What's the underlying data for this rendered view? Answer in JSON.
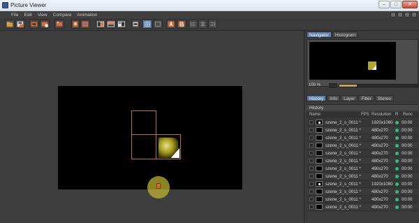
{
  "window": {
    "title": "Picture Viewer"
  },
  "menu": [
    "File",
    "Edit",
    "View",
    "Compare",
    "Animation"
  ],
  "side": {
    "top_tabs": [
      "Navigator",
      "Histogram"
    ],
    "zoom": "100 %",
    "zoom_fraction": 0.22,
    "bottom_tabs": [
      "History",
      "Info",
      "Layer",
      "Filter",
      "Stereo"
    ],
    "history_title": "History",
    "columns": {
      "name": "Name",
      "fps": "FPS",
      "resolution": "Resolution",
      "r": "R",
      "rend": "Renc"
    },
    "rows": [
      {
        "name": "szene_2_s_0011 *",
        "res": "1920x1080",
        "rend": "00:00",
        "thumb": "white"
      },
      {
        "name": "szene_2_s_0011 *",
        "res": "480x270",
        "rend": "00:00",
        "thumb": "black"
      },
      {
        "name": "szene_2_s_0011 *",
        "res": "480x270",
        "rend": "00:00",
        "thumb": "black"
      },
      {
        "name": "szene_2_s_0011 *",
        "res": "480x270",
        "rend": "00:00",
        "thumb": "black"
      },
      {
        "name": "szene_2_s_0011 *",
        "res": "480x270",
        "rend": "00:00",
        "thumb": "black"
      },
      {
        "name": "szene_2_s_0011 *",
        "res": "480x270",
        "rend": "00:00",
        "thumb": "black"
      },
      {
        "name": "szene_2_s_0011 *",
        "res": "480x270",
        "rend": "00:00",
        "thumb": "black"
      },
      {
        "name": "szene_2_s_0011 *",
        "res": "480x270",
        "rend": "00:00",
        "thumb": "black"
      },
      {
        "name": "szene_2_s_0011 *",
        "res": "1920x1080",
        "rend": "00:00",
        "thumb": "white"
      },
      {
        "name": "szene_2_s_0011 *",
        "res": "480x270",
        "rend": "00:00",
        "thumb": "black"
      },
      {
        "name": "szene_2_s_0011 *",
        "res": "480x270",
        "rend": "00:00",
        "thumb": "black"
      },
      {
        "name": "szene_2_s_0011 *",
        "res": "480x270",
        "rend": "00:00",
        "thumb": "black"
      }
    ]
  },
  "colors": {
    "accent_tab": "#5b7fb0",
    "status_dot": "#2fbf7d",
    "highlight": "#c4be30",
    "tile_border": "#c86a3a"
  },
  "icons": [
    "open-icon",
    "save-icon",
    "export-icon",
    "render-icon",
    "compare-icon",
    "ab-icon"
  ]
}
